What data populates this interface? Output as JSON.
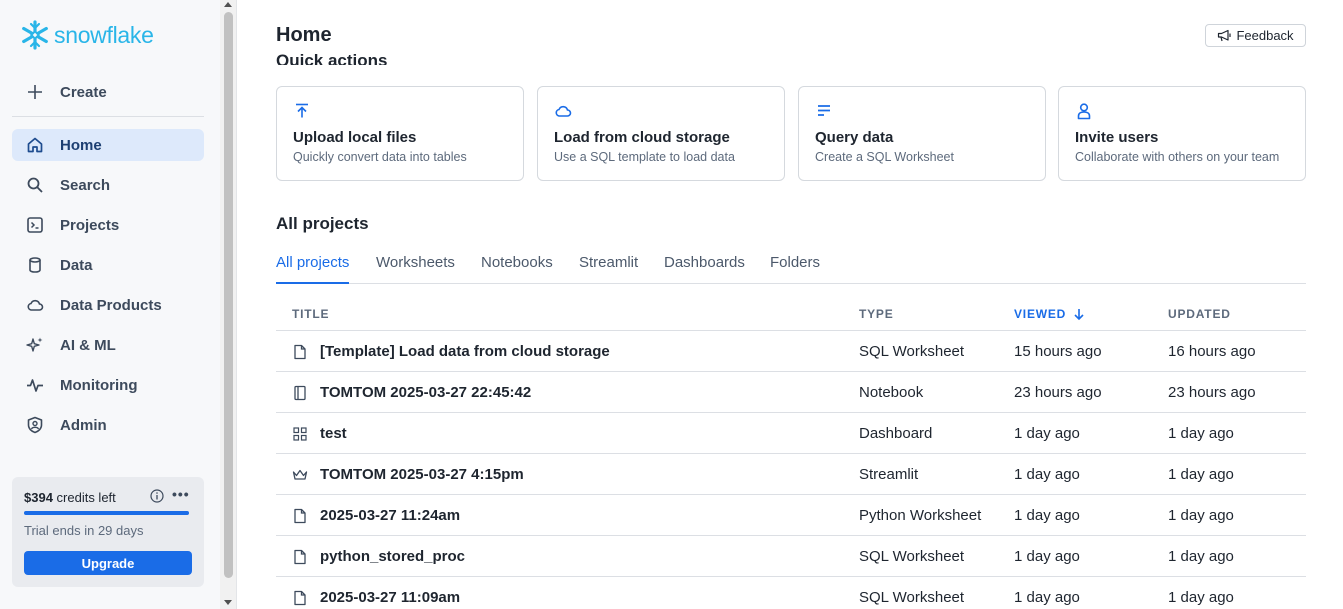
{
  "app": {
    "logo_text": "snowflake",
    "brand_color": "#29b5e8",
    "accent_color": "#1a6ce7"
  },
  "sidebar": {
    "create_label": "Create",
    "items": [
      {
        "label": "Home",
        "icon": "home-icon",
        "active": true
      },
      {
        "label": "Search",
        "icon": "search-icon"
      },
      {
        "label": "Projects",
        "icon": "terminal-icon"
      },
      {
        "label": "Data",
        "icon": "database-icon"
      },
      {
        "label": "Data Products",
        "icon": "cloud-icon"
      },
      {
        "label": "AI & ML",
        "icon": "sparkle-icon"
      },
      {
        "label": "Monitoring",
        "icon": "pulse-icon"
      },
      {
        "label": "Admin",
        "icon": "shield-user-icon"
      }
    ],
    "credits": {
      "amount": "$394",
      "suffix": " credits left",
      "progress": 1.0,
      "trial_text": "Trial ends in 29 days",
      "upgrade_label": "Upgrade"
    }
  },
  "header": {
    "title": "Home",
    "feedback_label": "Feedback"
  },
  "quick_actions": {
    "title": "Quick actions",
    "cards": [
      {
        "title": "Upload local files",
        "subtitle": "Quickly convert data into tables",
        "icon": "upload-icon"
      },
      {
        "title": "Load from cloud storage",
        "subtitle": "Use a SQL template to load data",
        "icon": "cloud-icon"
      },
      {
        "title": "Query data",
        "subtitle": "Create a SQL Worksheet",
        "icon": "lines-icon"
      },
      {
        "title": "Invite users",
        "subtitle": "Collaborate with others on your team",
        "icon": "user-icon"
      }
    ]
  },
  "projects": {
    "heading": "All projects",
    "tabs": [
      "All projects",
      "Worksheets",
      "Notebooks",
      "Streamlit",
      "Dashboards",
      "Folders"
    ],
    "active_tab": "All projects",
    "columns": {
      "title": "TITLE",
      "type": "TYPE",
      "viewed": "VIEWED",
      "updated": "UPDATED"
    },
    "rows": [
      {
        "icon": "file-icon",
        "title": "[Template] Load data from cloud storage",
        "type": "SQL Worksheet",
        "viewed": "15 hours ago",
        "updated": "16 hours ago"
      },
      {
        "icon": "notebook-icon",
        "title": "TOMTOM 2025-03-27 22:45:42",
        "type": "Notebook",
        "viewed": "23 hours ago",
        "updated": "23 hours ago"
      },
      {
        "icon": "dashboard-icon",
        "title": "test",
        "type": "Dashboard",
        "viewed": "1 day ago",
        "updated": "1 day ago"
      },
      {
        "icon": "crown-icon",
        "title": "TOMTOM 2025-03-27 4:15pm",
        "type": "Streamlit",
        "viewed": "1 day ago",
        "updated": "1 day ago"
      },
      {
        "icon": "file-icon",
        "title": "2025-03-27 11:24am",
        "type": "Python Worksheet",
        "viewed": "1 day ago",
        "updated": "1 day ago"
      },
      {
        "icon": "file-icon",
        "title": "python_stored_proc",
        "type": "SQL Worksheet",
        "viewed": "1 day ago",
        "updated": "1 day ago"
      },
      {
        "icon": "file-icon",
        "title": "2025-03-27 11:09am",
        "type": "SQL Worksheet",
        "viewed": "1 day ago",
        "updated": "1 day ago"
      }
    ]
  }
}
